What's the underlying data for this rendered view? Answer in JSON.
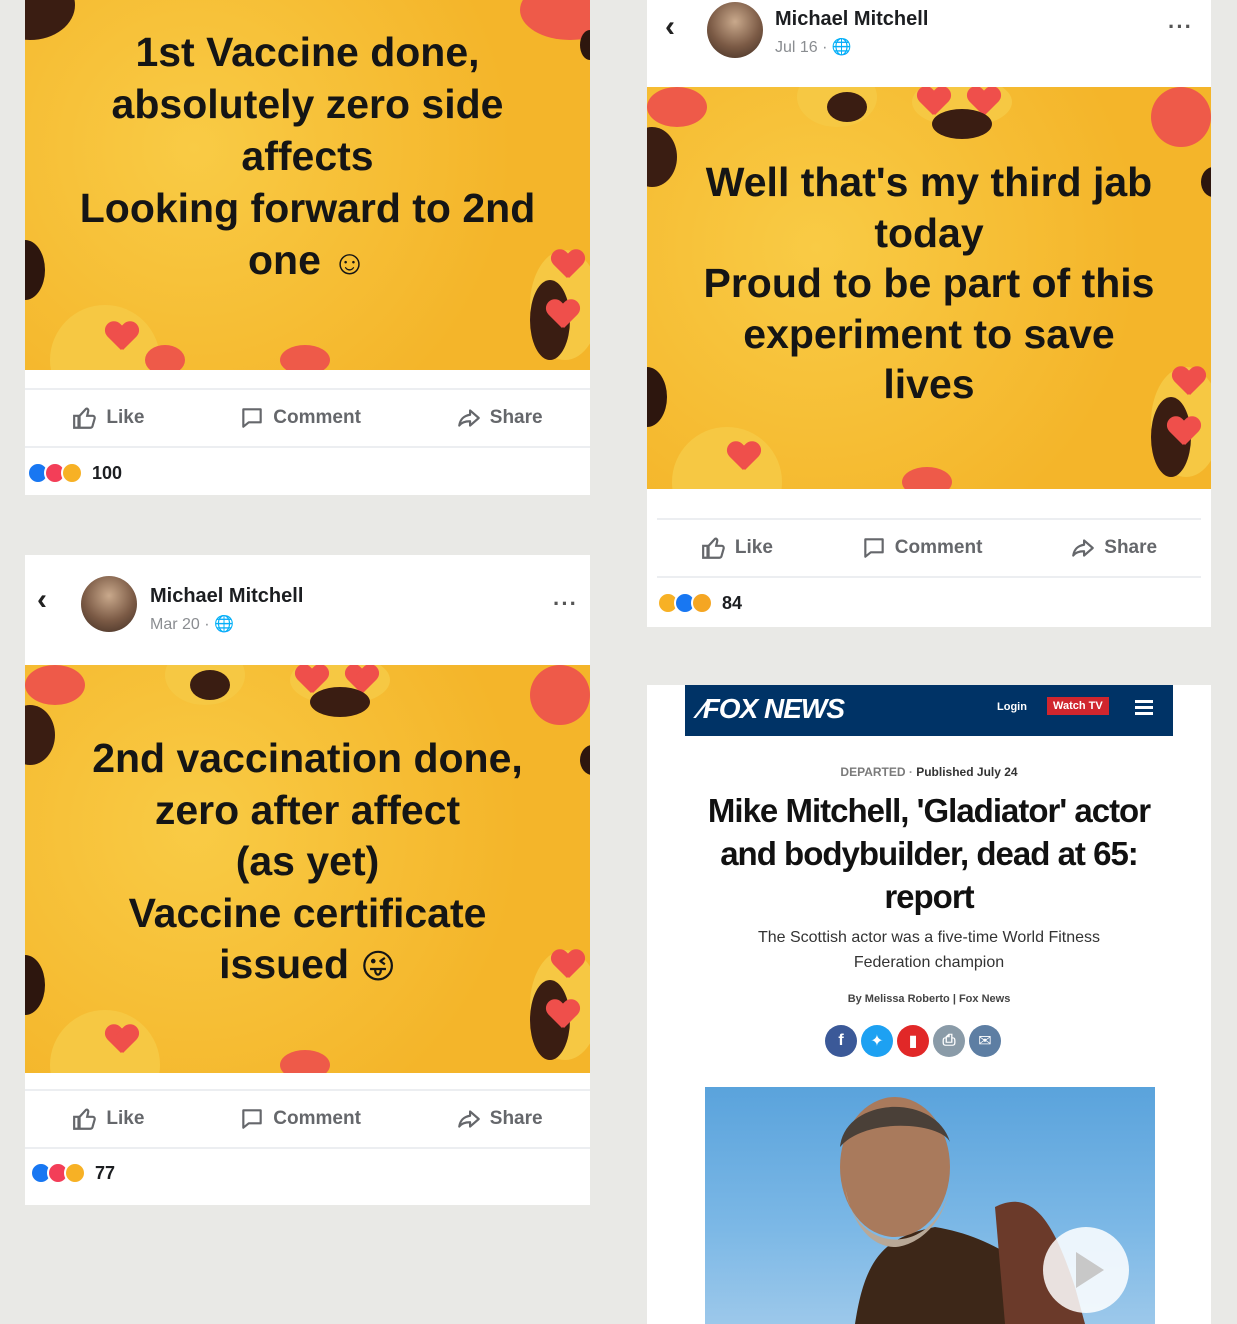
{
  "post1": {
    "text_lines": [
      "1st Vaccine done,",
      "absolutely zero side",
      "affects",
      "Looking forward to 2nd",
      "one"
    ],
    "actions": {
      "like": "Like",
      "comment": "Comment",
      "share": "Share"
    },
    "reaction_count": "100"
  },
  "post2": {
    "author": "Michael Mitchell",
    "date": "Jul 16 ·",
    "text_lines": [
      "Well that's my third jab",
      "today",
      "Proud to be part of this",
      "experiment to save",
      "lives"
    ],
    "actions": {
      "like": "Like",
      "comment": "Comment",
      "share": "Share"
    },
    "reaction_count": "84"
  },
  "post3": {
    "author": "Michael Mitchell",
    "date": "Mar 20 ·",
    "text_lines": [
      "2nd vaccination done,",
      "zero after affect",
      "(as yet)",
      "Vaccine certificate",
      "issued"
    ],
    "actions": {
      "like": "Like",
      "comment": "Comment",
      "share": "Share"
    },
    "reaction_count": "77"
  },
  "news": {
    "brand": "FOX NEWS",
    "login": "Login",
    "watch_tv": "Watch TV",
    "category": "DEPARTED",
    "published": "Published July 24",
    "headline_lines": [
      "Mike Mitchell, 'Gladiator' actor",
      "and bodybuilder, dead at 65:",
      "report"
    ],
    "subhead_lines": [
      "The Scottish actor was a five-time World Fitness",
      "Federation champion"
    ],
    "byline": "By Melissa Roberto | Fox News",
    "share_icons": [
      "facebook-icon",
      "twitter-icon",
      "flipboard-icon",
      "print-icon",
      "email-icon"
    ],
    "colors": {
      "fox_navy": "#003366",
      "watch_red": "#d0262e"
    }
  },
  "colors": {
    "post_yellow": "#f7bf2f",
    "heart_red": "#ef4f4b",
    "fb_gray": "#65676b"
  }
}
